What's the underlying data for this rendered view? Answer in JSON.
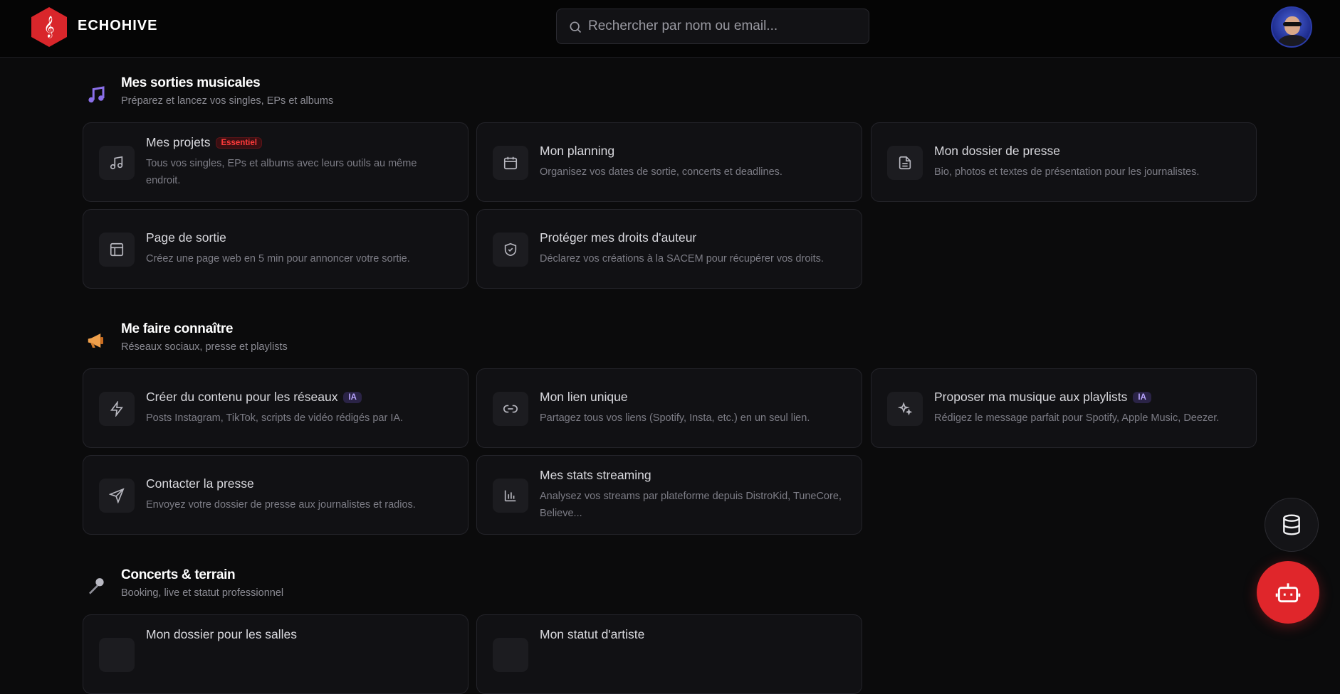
{
  "app": {
    "brand": "ECHOHIVE"
  },
  "search": {
    "placeholder": "Rechercher par nom ou email..."
  },
  "sections": [
    {
      "title": "Mes sorties musicales",
      "subtitle": "Préparez et lancez vos singles, EPs et albums",
      "icon": "music-note-icon",
      "cards": [
        {
          "title": "Mes projets",
          "badge": "Essentiel",
          "desc": "Tous vos singles, EPs et albums avec leurs outils au même endroit.",
          "icon": "music-icon"
        },
        {
          "title": "Mon planning",
          "desc": "Organisez vos dates de sortie, concerts et deadlines.",
          "icon": "calendar-icon"
        },
        {
          "title": "Mon dossier de presse",
          "desc": "Bio, photos et textes de présentation pour les journalistes.",
          "icon": "document-icon"
        },
        {
          "title": "Page de sortie",
          "desc": "Créez une page web en 5 min pour annoncer votre sortie.",
          "icon": "layout-icon"
        },
        {
          "title": "Protéger mes droits d'auteur",
          "desc": "Déclarez vos créations à la SACEM pour récupérer vos droits.",
          "icon": "shield-icon"
        }
      ]
    },
    {
      "title": "Me faire connaître",
      "subtitle": "Réseaux sociaux, presse et playlists",
      "icon": "megaphone-icon",
      "cards": [
        {
          "title": "Créer du contenu pour les réseaux",
          "badge": "IA",
          "desc": "Posts Instagram, TikTok, scripts de vidéo rédigés par IA.",
          "icon": "lightning-icon"
        },
        {
          "title": "Mon lien unique",
          "desc": "Partagez tous vos liens (Spotify, Insta, etc.) en un seul lien.",
          "icon": "link-icon"
        },
        {
          "title": "Proposer ma musique aux playlists",
          "badge": "IA",
          "desc": "Rédigez le message parfait pour Spotify, Apple Music, Deezer.",
          "icon": "sparkles-icon"
        },
        {
          "title": "Contacter la presse",
          "desc": "Envoyez votre dossier de presse aux journalistes et radios.",
          "icon": "send-icon"
        },
        {
          "title": "Mes stats streaming",
          "desc": "Analysez vos streams par plateforme depuis DistroKid, TuneCore, Believe...",
          "icon": "bar-chart-icon"
        }
      ]
    },
    {
      "title": "Concerts & terrain",
      "subtitle": "Booking, live et statut professionnel",
      "icon": "microphone-icon",
      "cards": [
        {
          "title": "Mon dossier pour les salles",
          "icon": "folder-icon"
        },
        {
          "title": "Mon statut d'artiste",
          "icon": "id-icon"
        }
      ]
    }
  ],
  "colors": {
    "brand_red": "#d9262b",
    "ia_purple": "#b9a6ff",
    "background": "#0b0b0c"
  },
  "fabs": {
    "database": "database-icon",
    "assistant": "robot-icon"
  }
}
